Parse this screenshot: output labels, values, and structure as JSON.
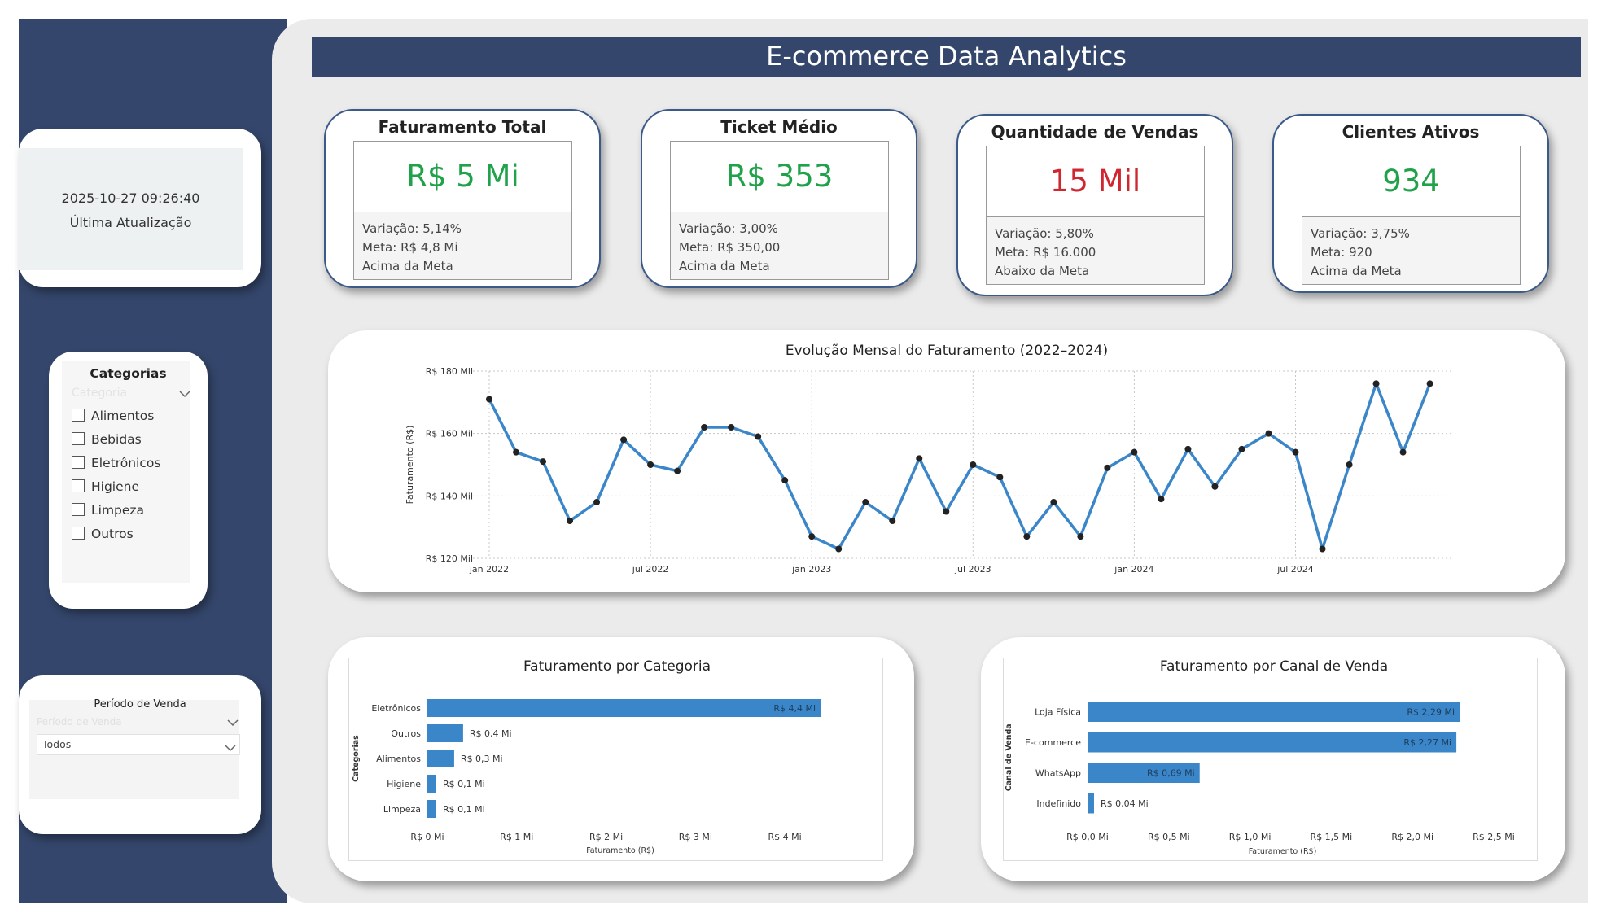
{
  "header": {
    "title": "E-commerce Data Analytics"
  },
  "last_update": {
    "timestamp": "2025-10-27 09:26:40",
    "label": "Última Atualização"
  },
  "categories_filter": {
    "title": "Categorias",
    "placeholder": "Categoria",
    "items": [
      "Alimentos",
      "Bebidas",
      "Eletrônicos",
      "Higiene",
      "Limpeza",
      "Outros"
    ]
  },
  "period_filter": {
    "title": "Período de Venda",
    "placeholder": "Período de Venda",
    "selected": "Todos"
  },
  "kpis": [
    {
      "title": "Faturamento Total",
      "value": "R$ 5 Mi",
      "color": "#1fa24a",
      "variation": "Variação: 5,14%",
      "goal": "Meta: R$ 4,8 Mi",
      "status": "Acima da Meta"
    },
    {
      "title": "Ticket Médio",
      "value": "R$ 353",
      "color": "#1fa24a",
      "variation": "Variação: 3,00%",
      "goal": "Meta: R$ 350,00",
      "status": "Acima da Meta"
    },
    {
      "title": "Quantidade de Vendas",
      "value": "15 Mil",
      "color": "#d0262f",
      "variation": "Variação: 5,80%",
      "goal": "Meta: R$ 16.000",
      "status": "Abaixo da Meta"
    },
    {
      "title": "Clientes Ativos",
      "value": "934",
      "color": "#1fa24a",
      "variation": "Variação: 3,75%",
      "goal": "Meta: 920",
      "status": "Acima da Meta"
    }
  ],
  "chart_data": [
    {
      "type": "line",
      "title": "Evolução Mensal do Faturamento (2022–2024)",
      "xlabel": "",
      "ylabel": "Faturamento (R$)",
      "x": [
        "2022-01",
        "2022-02",
        "2022-03",
        "2022-04",
        "2022-05",
        "2022-06",
        "2022-07",
        "2022-08",
        "2022-09",
        "2022-10",
        "2022-11",
        "2022-12",
        "2023-01",
        "2023-02",
        "2023-03",
        "2023-04",
        "2023-05",
        "2023-06",
        "2023-07",
        "2023-08",
        "2023-09",
        "2023-10",
        "2023-11",
        "2023-12",
        "2024-01",
        "2024-02",
        "2024-03",
        "2024-04",
        "2024-05",
        "2024-06",
        "2024-07",
        "2024-08",
        "2024-09",
        "2024-10",
        "2024-11",
        "2024-12"
      ],
      "series": [
        {
          "values": [
            171,
            154,
            151,
            132,
            138,
            158,
            150,
            148,
            162,
            162,
            159,
            145,
            127,
            123,
            138,
            132,
            152,
            135,
            150,
            146,
            127,
            138,
            127,
            149,
            154,
            139,
            155,
            143,
            155,
            160,
            154,
            123,
            150,
            176,
            154,
            176
          ],
          "color": "#3a86c8"
        }
      ],
      "ylim": [
        120,
        180
      ],
      "yticks": [
        120,
        140,
        160,
        180
      ],
      "ytick_labels": [
        "R$ 120 Mil",
        "R$ 140 Mil",
        "R$ 160 Mil",
        "R$ 180 Mil"
      ],
      "xticks": [
        "2022-01",
        "2022-07",
        "2023-01",
        "2023-07",
        "2024-01",
        "2024-07"
      ],
      "xtick_labels": [
        "jan 2022",
        "jul 2022",
        "jan 2023",
        "jul 2023",
        "jan 2024",
        "jul 2024"
      ],
      "grid": true
    },
    {
      "type": "bar",
      "orientation": "horizontal",
      "title": "Faturamento por Categoria",
      "xlabel": "Faturamento (R$)",
      "ylabel": "Categorias",
      "categories": [
        "Eletrônicos",
        "Outros",
        "Alimentos",
        "Higiene",
        "Limpeza"
      ],
      "values": [
        4.4,
        0.4,
        0.3,
        0.1,
        0.1
      ],
      "labels": [
        "R$ 4,4 Mi",
        "R$ 0,4 Mi",
        "R$ 0,3 Mi",
        "R$ 0,1 Mi",
        "R$ 0,1 Mi"
      ],
      "xlim": [
        0,
        4.5
      ],
      "xticks": [
        0,
        1,
        2,
        3,
        4
      ],
      "xtick_labels": [
        "R$ 0 Mi",
        "R$ 1 Mi",
        "R$ 2 Mi",
        "R$ 3 Mi",
        "R$ 4 Mi"
      ],
      "color": "#3a86c8"
    },
    {
      "type": "bar",
      "orientation": "horizontal",
      "title": "Faturamento por Canal de Venda",
      "xlabel": "Faturamento (R$)",
      "ylabel": "Canal de Venda",
      "categories": [
        "Loja Física",
        "E-commerce",
        "WhatsApp",
        "Indefinido"
      ],
      "values": [
        2.29,
        2.27,
        0.69,
        0.04
      ],
      "labels": [
        "R$ 2,29 Mi",
        "R$ 2,27 Mi",
        "R$ 0,69 Mi",
        "R$ 0,04 Mi"
      ],
      "xlim": [
        0,
        2.5
      ],
      "xticks": [
        0,
        0.5,
        1,
        1.5,
        2,
        2.5
      ],
      "xtick_labels": [
        "R$ 0,0 Mi",
        "R$ 0,5 Mi",
        "R$ 1,0 Mi",
        "R$ 1,5 Mi",
        "R$ 2,0 Mi",
        "R$ 2,5 Mi"
      ],
      "color": "#3a86c8"
    }
  ]
}
